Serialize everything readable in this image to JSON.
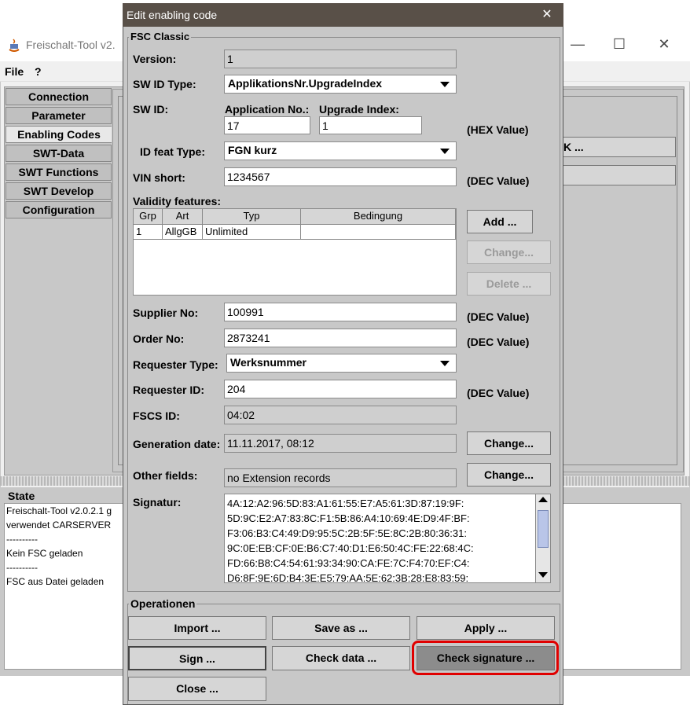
{
  "main": {
    "title": "Freischalt-Tool v2.",
    "menu": [
      "File",
      "?"
    ],
    "nav": [
      "Connection",
      "Parameter",
      "Enabling Codes",
      "SWT-Data",
      "SWT Functions",
      "SWT Develop",
      "Configuration"
    ],
    "right_fragment": "K ...",
    "state_title": "State",
    "state_lines": [
      "Freischalt-Tool v2.0.2.1 g",
      "verwendet CARSERVER",
      "----------",
      "Kein FSC geladen",
      "----------",
      "FSC aus Datei geladen"
    ]
  },
  "dialog": {
    "title": "Edit enabling code",
    "close_glyph": "✕",
    "group_title": "FSC Classic",
    "version_label": "Version:",
    "version_value": "1",
    "swid_type_label": "SW ID Type:",
    "swid_type_value": "ApplikationsNr.UpgradeIndex",
    "swid_label": "SW ID:",
    "app_no_label": "Application No.:",
    "upgrade_label": "Upgrade Index:",
    "app_no_value": "17",
    "upgrade_value": "1",
    "hex_value": "(HEX Value)",
    "idfeat_label": "ID feat Type:",
    "idfeat_value": "FGN kurz",
    "vin_label": "VIN short:",
    "vin_value": "1234567",
    "dec_value": "(DEC Value)",
    "validity_label": "Validity features:",
    "table_headers": [
      "Grp",
      "Art",
      "Typ",
      "Bedingung"
    ],
    "table_row": [
      "1",
      "AllgGB",
      "Unlimited",
      ""
    ],
    "add_btn": "Add ...",
    "change_btn_dis": "Change...",
    "delete_btn": "Delete ...",
    "supplier_label": "Supplier No:",
    "supplier_value": "100991",
    "order_label": "Order No:",
    "order_value": "2873241",
    "reqtype_label": "Requester Type:",
    "reqtype_value": "Werksnummer",
    "reqid_label": "Requester ID:",
    "reqid_value": "204",
    "fscs_label": "FSCS ID:",
    "fscs_value": "04:02",
    "gendate_label": "Generation date:",
    "gendate_value": "11.11.2017, 08:12",
    "change_btn": "Change...",
    "other_label": "Other fields:",
    "other_value": "no Extension records",
    "signatur_label": "Signatur:",
    "signatur_lines": [
      "4A:12:A2:96:5D:83:A1:61:55:E7:A5:61:3D:87:19:9F:",
      "5D:9C:E2:A7:83:8C:F1:5B:86:A4:10:69:4E:D9:4F:BF:",
      "F3:06:B3:C4:49:D9:95:5C:2B:5F:5E:8C:2B:80:36:31:",
      "9C:0E:EB:CF:0E:B6:C7:40:D1:E6:50:4C:FE:22:68:4C:",
      "FD:66:B8:C4:54:61:93:34:90:CA:FE:7C:F4:70:EF:C4:",
      "D6:8F:9E:6D:B4:3E:E5:79:AA:5E:62:3B:28:E8:83:59:"
    ],
    "ops_title": "Operationen",
    "import_btn": "Import ...",
    "saveas_btn": "Save as ...",
    "apply_btn": "Apply ...",
    "sign_btn": "Sign ...",
    "checkdata_btn": "Check data ...",
    "checksig_btn": "Check signature ...",
    "close_btn": "Close ..."
  }
}
